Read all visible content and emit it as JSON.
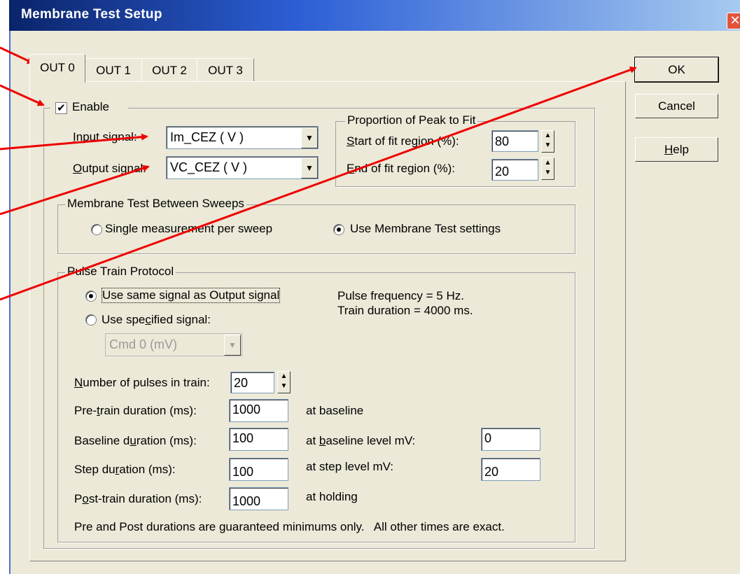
{
  "dialog": {
    "title": "Membrane Test Setup",
    "close_glyph": "✕"
  },
  "tabs": [
    {
      "label": "OUT 0",
      "active": true
    },
    {
      "label": "OUT 1",
      "active": false
    },
    {
      "label": "OUT 2",
      "active": false
    },
    {
      "label": "OUT 3",
      "active": false
    }
  ],
  "buttons": {
    "ok": "OK",
    "cancel": "Cancel",
    "help_pre": "",
    "help_u": "H",
    "help_post": "elp"
  },
  "enable": {
    "label": "Enable",
    "checked": true,
    "mark": "✔"
  },
  "signals": {
    "input_label_u": "I",
    "input_label_rest": "nput signal:",
    "input_value": "Im_CEZ ( V )",
    "output_label_u": "O",
    "output_label_rest": "utput signal:",
    "output_value": "VC_CEZ ( V )"
  },
  "peak_fit": {
    "title": "Proportion of Peak to Fit",
    "start_u": "S",
    "start_rest": "tart of fit region (%):",
    "start_value": "80",
    "end_u": "E",
    "end_rest": "nd of fit region (%):",
    "end_value": "20"
  },
  "between_sweeps": {
    "title": "Membrane Test Between Sweeps",
    "option_single": "Single measurement per sweep",
    "option_settings": "Use Membrane Test settings",
    "selected": "settings"
  },
  "pulse_train": {
    "title": "Pulse Train Protocol",
    "option_same": "Use same signal as Output signal",
    "option_specified_pre": "Use spe",
    "option_specified_u": "c",
    "option_specified_post": "ified signal:",
    "specified_value": "Cmd 0 (mV)",
    "selected": "same",
    "frequency": "Pulse frequency = 5 Hz.",
    "duration": "Train duration = 4000 ms.",
    "pulses_u": "N",
    "pulses_rest": "umber of pulses in train:",
    "pulses_value": "20",
    "pre_pre": "Pre-",
    "pre_u": "t",
    "pre_post": "rain duration (ms):",
    "pre_value": "1000",
    "pre_note": "at baseline",
    "base_pre": "Baseline d",
    "base_u": "u",
    "base_post": "ration (ms):",
    "base_value": "100",
    "base_note_pre": "at ",
    "base_note_u": "b",
    "base_note_post": "aseline level mV:",
    "base_level": "0",
    "step_pre": "Step du",
    "step_u": "r",
    "step_post": "ation (ms):",
    "step_value": "100",
    "step_note": "at step level mV:",
    "step_level": "20",
    "post_pre": "P",
    "post_u": "o",
    "post_post": "st-train duration (ms):",
    "post_value": "1000",
    "post_note": "at holding",
    "footer": "Pre and Post durations are guaranteed minimums only.   All other times are exact."
  },
  "glyphs": {
    "down_arrow": "▼",
    "up_small": "▲",
    "down_small": "▼"
  },
  "colors": {
    "annotation_arrow": "#ee0000",
    "title_bar": "#0a246a",
    "dialog_bg": "#ece9d8"
  }
}
